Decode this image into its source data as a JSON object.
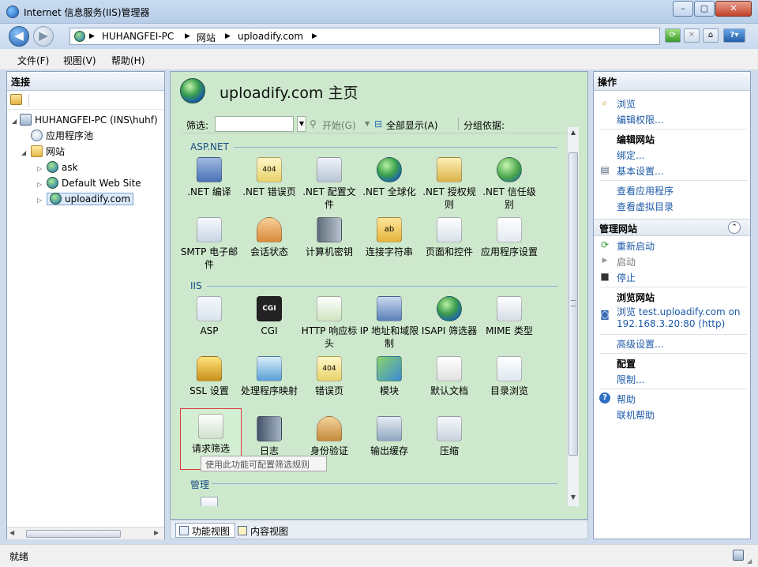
{
  "window": {
    "title": "Internet 信息服务(IIS)管理器",
    "min": "–",
    "max": "▢",
    "close": "✕"
  },
  "address": {
    "crumbs": [
      "HUHANGFEI-PC",
      "网站",
      "uploadify.com"
    ],
    "sep": "▶"
  },
  "menu": [
    "文件(F)",
    "视图(V)",
    "帮助(H)"
  ],
  "left": {
    "header": "连接",
    "tree": [
      {
        "label": "HUHANGFEI-PC (INS\\huhf)",
        "icon": "server-icon",
        "level": 0
      },
      {
        "label": "应用程序池",
        "icon": "app-pool-icon",
        "level": 1
      },
      {
        "label": "网站",
        "icon": "sites-folder-icon",
        "level": 1
      },
      {
        "label": "ask",
        "icon": "globe-icon",
        "level": 2
      },
      {
        "label": "Default Web Site",
        "icon": "globe-icon",
        "level": 2
      },
      {
        "label": "uploadify.com",
        "icon": "globe-icon",
        "level": 2,
        "selected": true
      }
    ]
  },
  "center": {
    "title": "uploadify.com 主页",
    "filter": {
      "label": "筛选:",
      "value": "",
      "start": "开始(G)",
      "show_all": "全部显示(A)",
      "group_by": "分组依据:"
    },
    "groups": [
      {
        "label": "ASP.NET",
        "items": [
          {
            "label": ".NET 编译",
            "icon": "dotnet-compile-icon",
            "color": "#6a8fc7"
          },
          {
            "label": ".NET 错误页",
            "icon": "dotnet-error-page-icon",
            "color": "#e9d36b"
          },
          {
            "label": ".NET 配置文件",
            "icon": "dotnet-profile-icon",
            "color": "#b9c6d6"
          },
          {
            "label": ".NET 全球化",
            "icon": "dotnet-globalization-icon",
            "color": "#3f8fd6"
          },
          {
            "label": ".NET 授权规则",
            "icon": "dotnet-authorization-icon",
            "color": "#d9b24a"
          },
          {
            "label": ".NET 信任级别",
            "icon": "dotnet-trust-icon",
            "color": "#4aa64a"
          },
          {
            "label": "SMTP 电子邮件",
            "icon": "smtp-mail-icon",
            "color": "#c9d6e6"
          },
          {
            "label": "会话状态",
            "icon": "session-state-icon",
            "color": "#d98a3a"
          },
          {
            "label": "计算机密钥",
            "icon": "machine-key-icon",
            "color": "#8a98a8"
          },
          {
            "label": "连接字符串",
            "icon": "connection-string-icon",
            "color": "#e6b43c"
          },
          {
            "label": "页面和控件",
            "icon": "pages-controls-icon",
            "color": "#d7e0ea"
          },
          {
            "label": "应用程序设置",
            "icon": "app-settings-icon",
            "color": "#e3e9f0"
          }
        ]
      },
      {
        "label": "IIS",
        "items": [
          {
            "label": "ASP",
            "icon": "asp-icon",
            "color": "#d9e3ee"
          },
          {
            "label": "CGI",
            "icon": "cgi-icon",
            "color": "#222222"
          },
          {
            "label": "HTTP 响应标头",
            "icon": "http-headers-icon",
            "color": "#7fbf5a"
          },
          {
            "label": "IP 地址和域限制",
            "icon": "ip-restrict-icon",
            "color": "#5a7fb8"
          },
          {
            "label": "ISAPI 筛选器",
            "icon": "isapi-filter-icon",
            "color": "#3a8ad6"
          },
          {
            "label": "MIME 类型",
            "icon": "mime-types-icon",
            "color": "#e6e6e6"
          },
          {
            "label": "SSL 设置",
            "icon": "ssl-lock-icon",
            "color": "#e0b02a"
          },
          {
            "label": "处理程序映射",
            "icon": "handler-mapping-icon",
            "color": "#5aa0d6"
          },
          {
            "label": "错误页",
            "icon": "error-page-icon",
            "color": "#e9d36b"
          },
          {
            "label": "模块",
            "icon": "modules-icon",
            "color": "#4ab04a"
          },
          {
            "label": "默认文档",
            "icon": "default-document-icon",
            "color": "#f2f2f2"
          },
          {
            "label": "目录浏览",
            "icon": "directory-browse-icon",
            "color": "#dfe7f0"
          },
          {
            "label": "请求筛选",
            "icon": "request-filter-icon",
            "color": "#5cb85c",
            "selected": true
          },
          {
            "label": "日志",
            "icon": "log-icon",
            "color": "#6f7f96"
          },
          {
            "label": "身份验证",
            "icon": "authentication-icon",
            "color": "#c48a3a"
          },
          {
            "label": "输出缓存",
            "icon": "output-cache-icon",
            "color": "#8fa6c0"
          },
          {
            "label": "压缩",
            "icon": "compression-icon",
            "color": "#c9d3de"
          }
        ]
      },
      {
        "label": "管理",
        "items": []
      }
    ],
    "tooltip": "使用此功能可配置筛选规则",
    "tabs": [
      "功能视图",
      "内容视图"
    ]
  },
  "right": {
    "header": "操作",
    "browse": "浏览",
    "edit_perms": "编辑权限...",
    "edit_site": "编辑网站",
    "bindings": "绑定...",
    "basic_settings": "基本设置...",
    "view_apps": "查看应用程序",
    "view_vdirs": "查看虚拟目录",
    "manage_site": "管理网站",
    "restart": "重新启动",
    "start": "启动",
    "stop": "停止",
    "browse_site": "浏览网站",
    "browse_url1": "浏览 test.uploadify.com on",
    "browse_url2": "192.168.3.20:80 (http)",
    "advanced": "高级设置...",
    "config": "配置",
    "limits": "限制...",
    "help": "帮助",
    "online_help": "联机帮助"
  },
  "status": "就绪"
}
